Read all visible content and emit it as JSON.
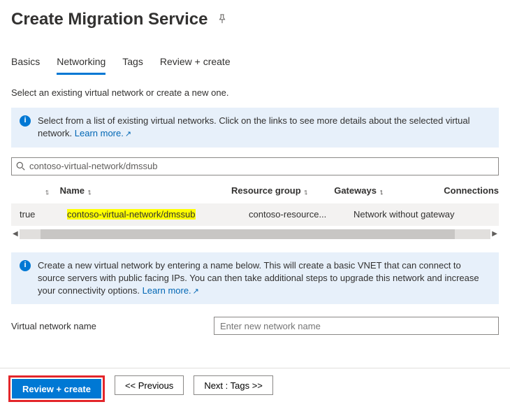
{
  "header": {
    "title": "Create Migration Service"
  },
  "tabs": {
    "items": [
      {
        "label": "Basics"
      },
      {
        "label": "Networking"
      },
      {
        "label": "Tags"
      },
      {
        "label": "Review + create"
      }
    ],
    "active_index": 1
  },
  "intro": "Select an existing virtual network or create a new one.",
  "info_existing": {
    "text": "Select from a list of existing virtual networks. Click on the links to see more details about the selected virtual network.",
    "link": "Learn more."
  },
  "search_value": "contoso-virtual-network/dmssub",
  "columns": {
    "name": "Name",
    "rg": "Resource group",
    "gw": "Gateways",
    "conn": "Connections"
  },
  "row": {
    "selected": "true",
    "name": "contoso-virtual-network/dmssub",
    "rg": "contoso-resource...",
    "gw": "Network without gateway"
  },
  "info_new": {
    "text": "Create a new virtual network by entering a name below. This will create a basic VNET that can connect to source servers with public facing IPs. You can then take additional steps to upgrade this network and increase your connectivity options. ",
    "link": "Learn more."
  },
  "vnet_field": {
    "label": "Virtual network name",
    "placeholder": "Enter new network name"
  },
  "footer": {
    "review": "Review + create",
    "prev": "<< Previous",
    "next": "Next : Tags >>"
  }
}
